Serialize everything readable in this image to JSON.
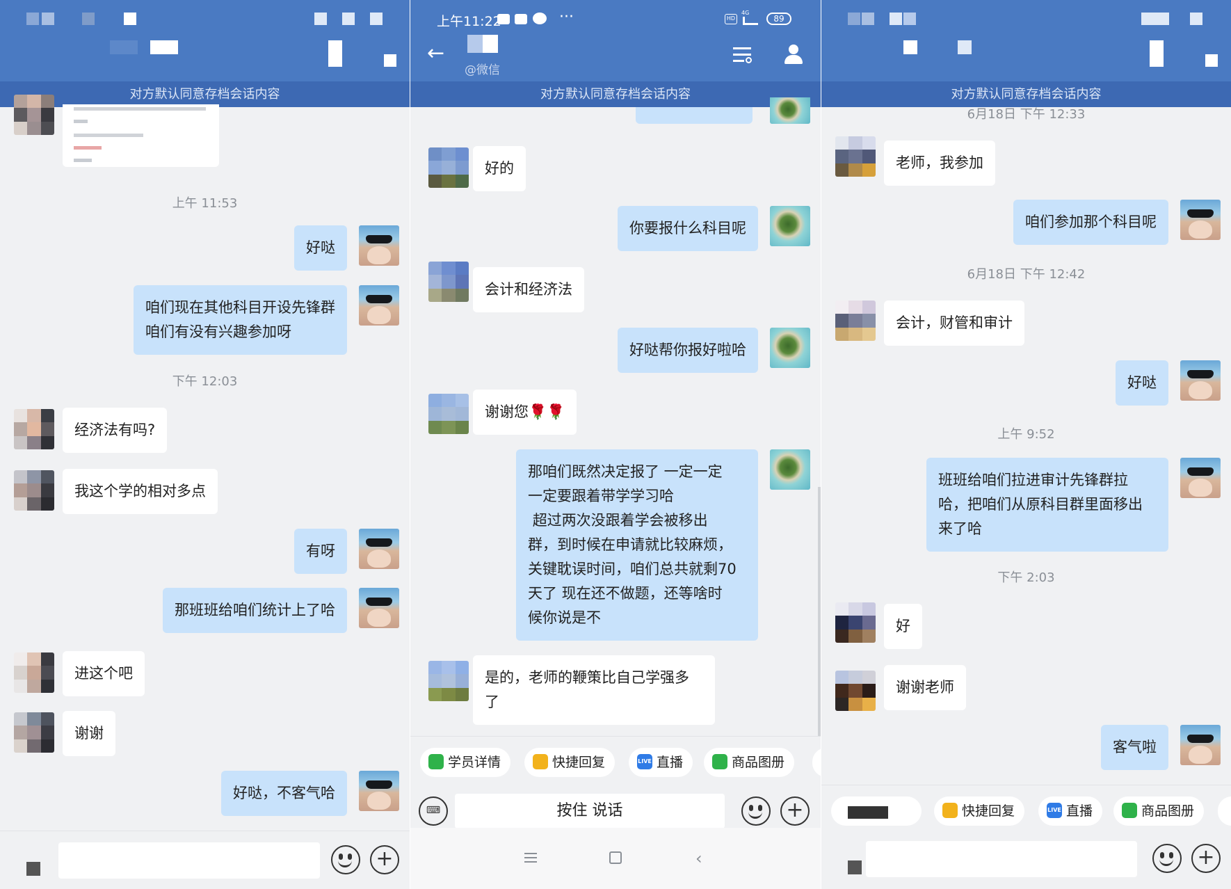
{
  "notice_text": "对方默认同意存档会话内容",
  "panel1": {
    "timestamps": [
      "上午 11:53",
      "下午 12:03"
    ],
    "messages": [
      {
        "dir": "out",
        "text": "好哒"
      },
      {
        "dir": "out",
        "text": "咱们现在其他科目开设先锋群\n咱们有没有兴趣参加呀"
      },
      {
        "dir": "in",
        "text": "经济法有吗?"
      },
      {
        "dir": "in",
        "text": "我这个学的相对多点"
      },
      {
        "dir": "out",
        "text": "有呀"
      },
      {
        "dir": "out",
        "text": "那班班给咱们统计上了哈"
      },
      {
        "dir": "in",
        "text": "进这个吧"
      },
      {
        "dir": "in",
        "text": "谢谢"
      },
      {
        "dir": "out",
        "text": "好哒，不客气哈"
      }
    ]
  },
  "panel2": {
    "status_time": "上午11:22",
    "status_icons": [
      "message-icon",
      "message-icon",
      "wechat-icon",
      "more-icon"
    ],
    "status_right": {
      "hd": "HD",
      "network": "4G",
      "battery": "89"
    },
    "contact_sub": "@微信",
    "messages": [
      {
        "dir": "in",
        "text": "好的"
      },
      {
        "dir": "out",
        "text": "你要报什么科目呢"
      },
      {
        "dir": "in",
        "text": "会计和经济法"
      },
      {
        "dir": "out",
        "text": "好哒帮你报好啦哈"
      },
      {
        "dir": "in",
        "text": "谢谢您🌹🌹"
      },
      {
        "dir": "out",
        "text": "那咱们既然决定报了 一定一定\n一定要跟着带学学习哈\n 超过两次没跟着学会被移出\n群，到时候在申请就比较麻烦，\n关键耽误时间，咱们总共就剩70\n天了 现在还不做题，还等啥时\n候你说是不"
      },
      {
        "dir": "in",
        "text": "是的，老师的鞭策比自己学强多\n了"
      }
    ],
    "toolbar": {
      "chips": [
        "学员详情",
        "快捷回复",
        "直播",
        "商品图册"
      ],
      "hold_to_talk": "按住 说话"
    }
  },
  "panel3": {
    "timestamps": [
      "6月18日  下午 12:33",
      "6月18日  下午 12:42",
      "上午 9:52",
      "下午 2:03"
    ],
    "messages": [
      {
        "dir": "in",
        "text": "老师，我参加"
      },
      {
        "dir": "out",
        "text": "咱们参加那个科目呢"
      },
      {
        "dir": "in",
        "text": "会计，财管和审计"
      },
      {
        "dir": "out",
        "text": "好哒"
      },
      {
        "dir": "out",
        "text": "班班给咱们拉进审计先锋群拉\n哈，把咱们从原科目群里面移出\n来了哈"
      },
      {
        "dir": "in",
        "text": "好"
      },
      {
        "dir": "in",
        "text": "谢谢老师"
      },
      {
        "dir": "out",
        "text": "客气啦"
      }
    ],
    "toolbar": {
      "chips": [
        "快捷回复",
        "直播",
        "商品图册"
      ]
    }
  },
  "live_badge": "LIVE",
  "colors": {
    "header_blue": "#4a7ac2",
    "notice_blue": "#3d69b3",
    "out_bubble": "#c8e2fb",
    "in_bubble": "#ffffff",
    "background": "#f0f1f3"
  }
}
